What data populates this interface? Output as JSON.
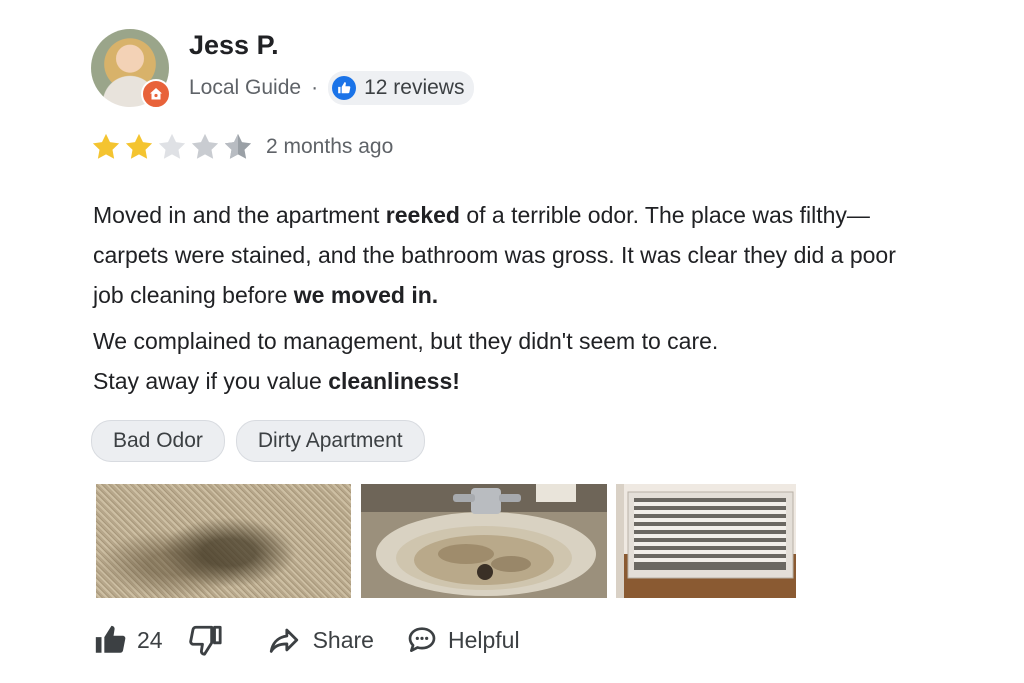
{
  "reviewer": {
    "name": "Jess P.",
    "role": "Local Guide",
    "separator": "·",
    "reviews_count_label": "12 reviews"
  },
  "rating": {
    "stars": 2,
    "max_stars": 5,
    "time": "2 months ago"
  },
  "body": {
    "p1_a": "Moved in and the apartment ",
    "p1_bold": "reeked",
    "p1_b": " of a terrible odor. The place was filthy—carpets were stained, and the bathroom was gross. It was clear they did a poor job cleaning before ",
    "p1_bold2": "we moved in.",
    "p2_line1": "We complained to management, but they didn't seem to care.",
    "p2_line2_a": "Stay away if you value ",
    "p2_line2_bold": "cleanliness!"
  },
  "tags": [
    "Bad Odor",
    "Dirty Apartment"
  ],
  "photos": [
    "stained-carpet-photo",
    "dirty-sink-photo",
    "dusty-vent-photo"
  ],
  "actions": {
    "like_count": "24",
    "share_label": "Share",
    "helpful_label": "Helpful"
  },
  "colors": {
    "star_filled": "#f4c430",
    "star_empty": "#c9ccd1",
    "accent_blue": "#1a73e8",
    "badge_orange": "#e8623a"
  },
  "icons": [
    "thumbs-up-icon",
    "thumbs-down-icon",
    "share-arrow-icon",
    "chat-bubble-icon",
    "local-guide-badge-icon"
  ]
}
